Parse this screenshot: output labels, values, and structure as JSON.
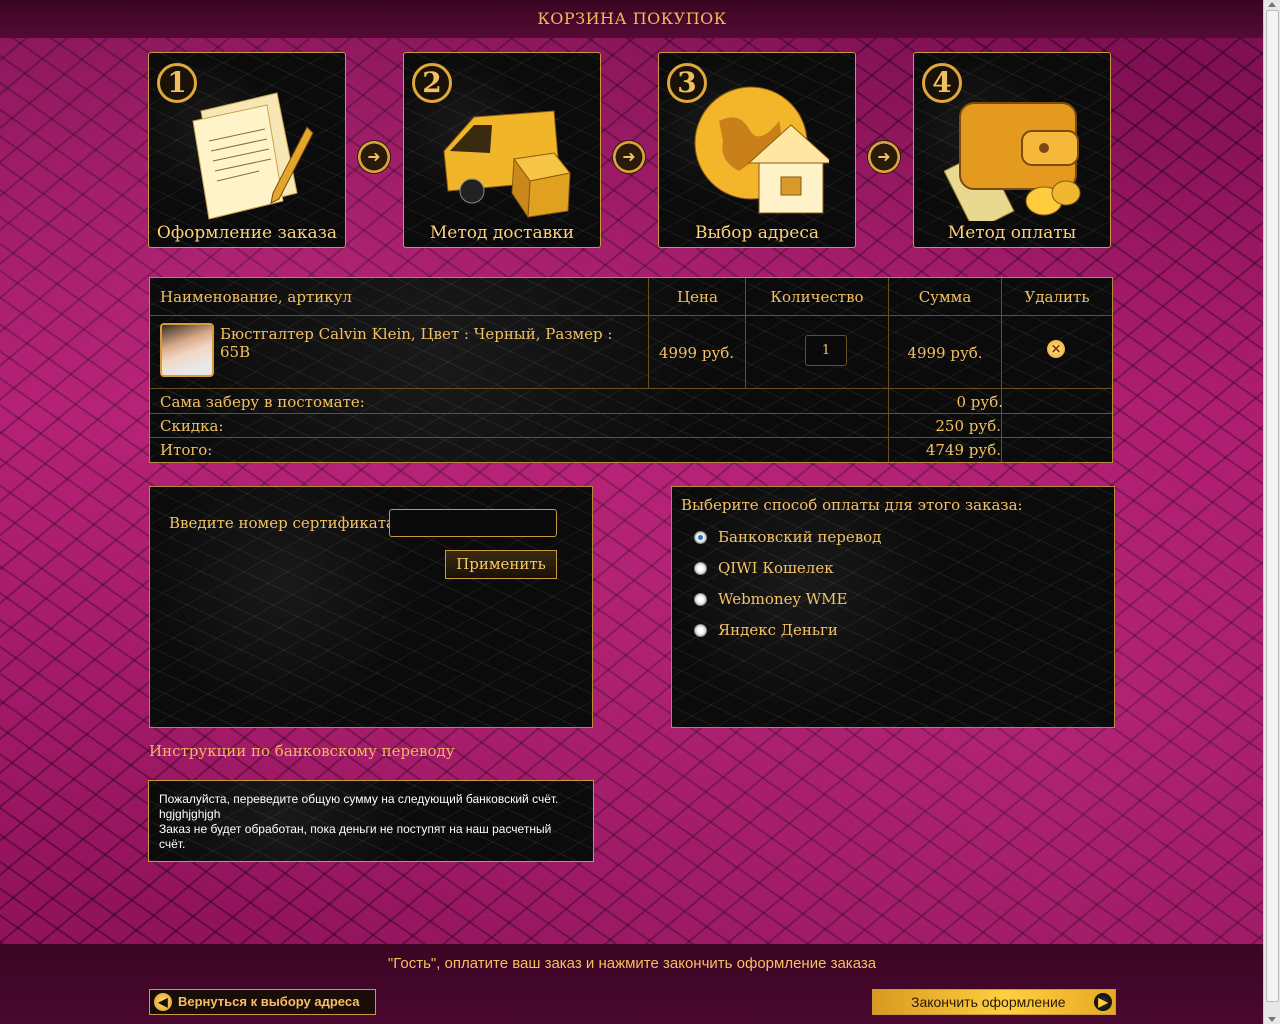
{
  "header": {
    "title": "КОРЗИНА ПОКУПОК"
  },
  "steps": [
    {
      "number": "1",
      "label": "Оформление заказа",
      "icon": "document-pen-icon"
    },
    {
      "number": "2",
      "label": "Метод доставки",
      "icon": "delivery-van-icon"
    },
    {
      "number": "3",
      "label": "Выбор адреса",
      "icon": "globe-house-icon"
    },
    {
      "number": "4",
      "label": "Метод оплаты",
      "icon": "wallet-coins-icon"
    }
  ],
  "cart": {
    "columns": [
      "Наименование, артикул",
      "Цена",
      "Количество",
      "Сумма",
      "Удалить"
    ],
    "items": [
      {
        "name": "Бюстгалтер Calvin Klein, Цвет : Черный, Размер : 65B",
        "price": "4999 руб.",
        "quantity": "1",
        "sum": "4999 руб."
      }
    ],
    "summary": [
      {
        "label": "Сама заберу в постомате:",
        "value": "0 руб."
      },
      {
        "label": "Скидка:",
        "value": "250 руб."
      },
      {
        "label": "Итого:",
        "value": "4749 руб."
      }
    ]
  },
  "certificate": {
    "label": "Введите номер сертификата",
    "value": "",
    "apply_label": "Применить"
  },
  "payment": {
    "title": "Выберите способ оплаты для этого заказа:",
    "options": [
      "Банковский перевод",
      "QIWI Кошелек",
      "Webmoney WME",
      "Яндекс Деньги"
    ],
    "selected": "Банковский перевод"
  },
  "instructions": {
    "title": "Инструкции по банковскому переводу",
    "lines": [
      "Пожалуйста, переведите общую сумму на следующий банковский счёт.",
      "hgjghjghjgh",
      "Заказ не будет обработан, пока деньги не поступят на наш расчетный",
      "счёт."
    ]
  },
  "footer": {
    "message": "\"Гость\", оплатите ваш заказ и нажмите закончить оформление заказа",
    "back_label": "Вернуться к выбору адреса",
    "finish_label": "Закончить оформление"
  }
}
